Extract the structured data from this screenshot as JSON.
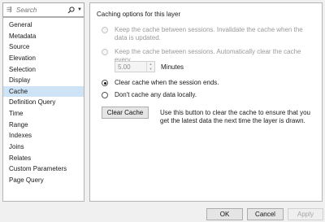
{
  "search": {
    "placeholder": "Search"
  },
  "nav": {
    "items": [
      {
        "label": "General",
        "active": false
      },
      {
        "label": "Metadata",
        "active": false
      },
      {
        "label": "Source",
        "active": false
      },
      {
        "label": "Elevation",
        "active": false
      },
      {
        "label": "Selection",
        "active": false
      },
      {
        "label": "Display",
        "active": false
      },
      {
        "label": "Cache",
        "active": true
      },
      {
        "label": "Definition Query",
        "active": false
      },
      {
        "label": "Time",
        "active": false
      },
      {
        "label": "Range",
        "active": false
      },
      {
        "label": "Indexes",
        "active": false
      },
      {
        "label": "Joins",
        "active": false
      },
      {
        "label": "Relates",
        "active": false
      },
      {
        "label": "Custom Parameters",
        "active": false
      },
      {
        "label": "Page Query",
        "active": false
      }
    ]
  },
  "panel": {
    "title": "Caching options for this layer",
    "options": {
      "keep_invalidate": "Keep the cache between sessions. Invalidate the cache when the data is updated.",
      "keep_auto_clear": "Keep the cache between sessions. Automatically clear the cache every",
      "clear_session_end": "Clear cache when the session ends.",
      "dont_cache": "Don't cache any data locally."
    },
    "interval": {
      "value": "5.00",
      "unit": "Minutes"
    },
    "clear_cache_button": "Clear Cache",
    "clear_cache_description": "Use this button to clear the cache to ensure that you get the latest data the next time the layer is drawn."
  },
  "footer": {
    "ok": "OK",
    "cancel": "Cancel",
    "apply": "Apply"
  },
  "colors": {
    "selected_nav": "#cfe3f6",
    "background": "#f0f0f0"
  }
}
